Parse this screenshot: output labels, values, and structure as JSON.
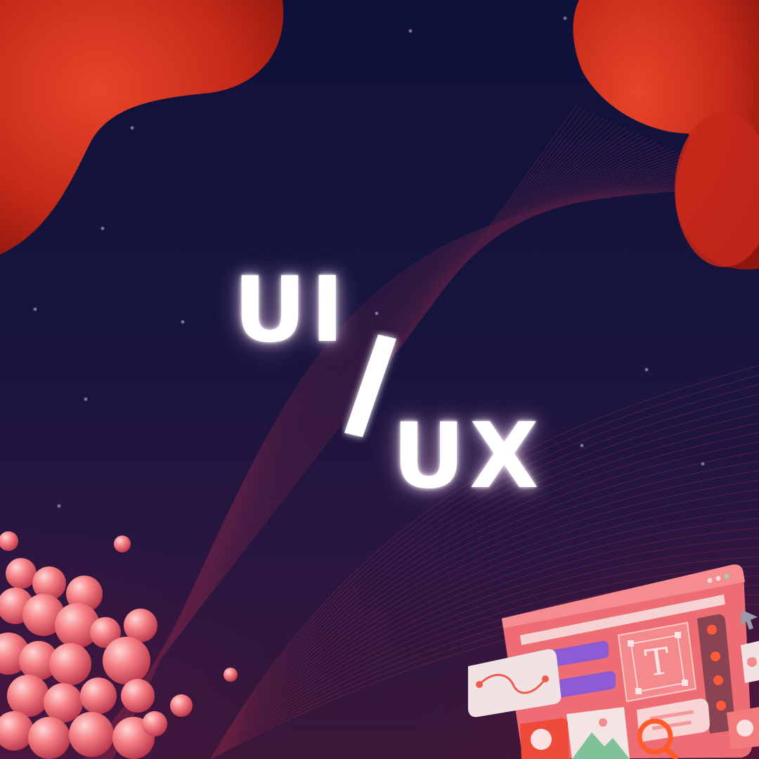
{
  "title": {
    "part1": "UI",
    "part2": "UX"
  },
  "colors": {
    "background": "#12123a",
    "blob": "#d0301c",
    "accent_pink": "#f36a6e",
    "glow": "#ffffff",
    "purple_pill": "#8e5bd6"
  },
  "illustration": {
    "editor_glyph": "T",
    "icons": [
      "curve-card-icon",
      "text-tool-icon",
      "image-icon",
      "magnifier-icon",
      "slider-icon"
    ]
  }
}
